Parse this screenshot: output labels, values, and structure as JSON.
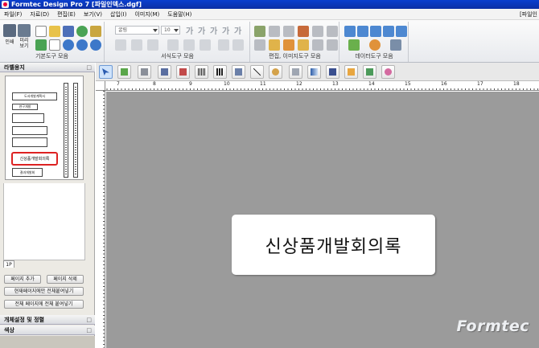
{
  "window": {
    "title": "Formtec Design Pro 7 [파일인덱스.dgf]"
  },
  "menu": {
    "items": [
      "파일(F)",
      "자료(D)",
      "편집(E)",
      "보기(V)",
      "삽입(I)",
      "이미지(M)",
      "도움말(H)"
    ],
    "right_label": "[파일인"
  },
  "ribbon": {
    "groups": [
      {
        "label": "기본도구 모음"
      },
      {
        "label": "서식도구 모음"
      },
      {
        "label": "편집, 이미지도구 모음"
      },
      {
        "label": "데이터도구 모음"
      }
    ],
    "print_label": "인쇄",
    "preview_label": "미리\n보기",
    "font_combo": "굴림",
    "size_combo": "10",
    "text_buttons": [
      "가",
      "가",
      "가",
      "가",
      "가"
    ]
  },
  "left_panel": {
    "title": "라벨용지",
    "page_tab": "1P",
    "buttons": {
      "add_page": "페이지 추가",
      "delete_page": "페이지 삭제",
      "paste_current": "현재페이지에만 전체붙여넣기",
      "paste_all": "전체 페이지에 전체 붙여넣기"
    },
    "sections": [
      "개체설정 및 정렬",
      "색상"
    ],
    "toggle_glyph": "□",
    "thumbnail": {
      "boxes": [
        "도서개발계획서",
        "연구개발",
        "신상품개발회의록",
        "결과개발회"
      ]
    }
  },
  "ruler": {
    "numbers": [
      "7",
      "8",
      "9",
      "10",
      "11",
      "12",
      "13",
      "14",
      "15",
      "16",
      "17",
      "18"
    ]
  },
  "canvas": {
    "label_text": "신상품개발회의록",
    "logo_text": "Formtec"
  },
  "colors": {
    "titlebar": "#0b36c0",
    "canvas": "#9b9b9b",
    "selection": "#cfe3fb"
  }
}
